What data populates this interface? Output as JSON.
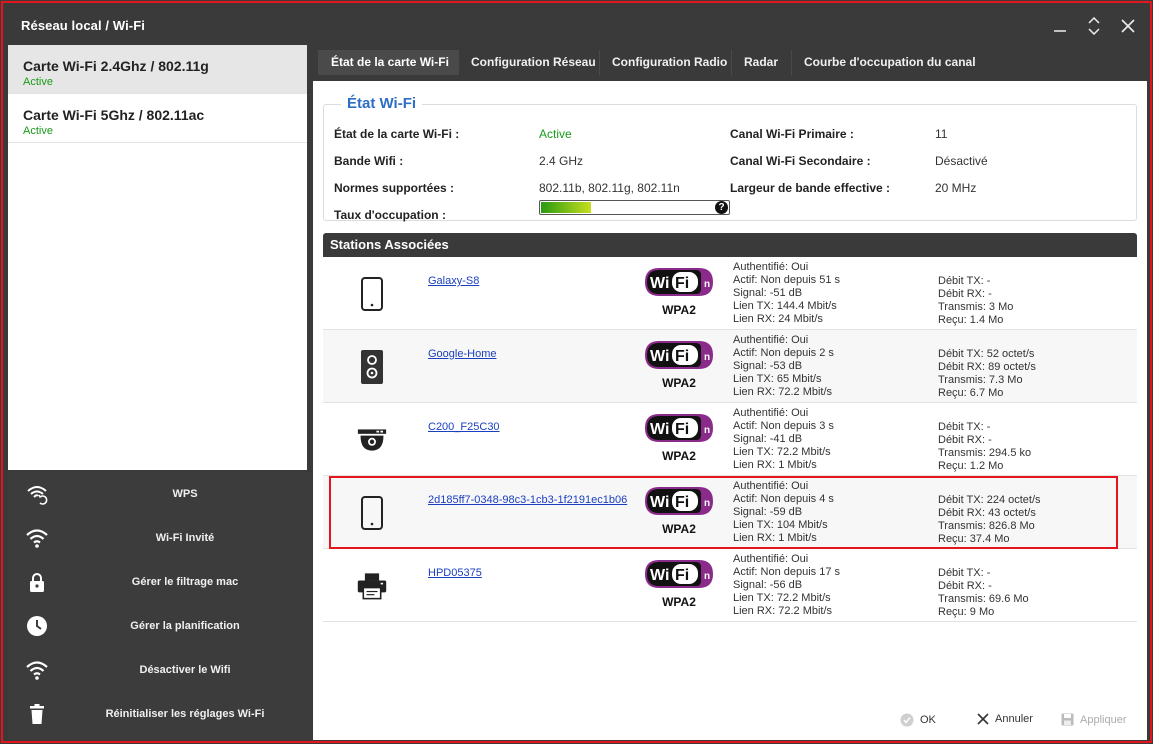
{
  "window": {
    "title": "Réseau local / Wi-Fi"
  },
  "cards": [
    {
      "name": "Carte Wi-Fi 2.4Ghz / 802.11g",
      "state": "Active"
    },
    {
      "name": "Carte Wi-Fi 5Ghz / 802.11ac",
      "state": "Active"
    }
  ],
  "actions": [
    {
      "label": "WPS",
      "icon": "wps-icon"
    },
    {
      "label": "Wi-Fi Invité",
      "icon": "wifi-icon"
    },
    {
      "label": "Gérer le filtrage mac",
      "icon": "lock-icon"
    },
    {
      "label": "Gérer la planification",
      "icon": "clock-icon"
    },
    {
      "label": "Désactiver le Wifi",
      "icon": "wifi-off-icon"
    },
    {
      "label": "Réinitialiser les réglages Wi-Fi",
      "icon": "trash-icon"
    }
  ],
  "tabs": [
    {
      "label": "État de la carte Wi-Fi"
    },
    {
      "label": "Configuration Réseau"
    },
    {
      "label": "Configuration Radio"
    },
    {
      "label": "Radar"
    },
    {
      "label": "Courbe d'occupation du canal"
    }
  ],
  "status": {
    "title": "État Wi-Fi",
    "card_state_label": "État de la carte Wi-Fi :",
    "card_state_value": "Active",
    "band_label": "Bande Wifi :",
    "band_value": "2.4 GHz",
    "norms_label": "Normes supportées :",
    "norms_value": "802.11b, 802.11g, 802.11n",
    "occupancy_label": "Taux d'occupation :",
    "occupancy_fraction": 0.27,
    "occupancy_help": "?",
    "primary_label": "Canal Wi-Fi Primaire :",
    "primary_value": "11",
    "secondary_label": "Canal Wi-Fi Secondaire :",
    "secondary_value": "Désactivé",
    "bandwidth_label": "Largeur de bande effective :",
    "bandwidth_value": "20 MHz"
  },
  "stations_title": "Stations Associées",
  "wifi_logo": {
    "text_wi": "Wi",
    "text_fi": "Fi",
    "text_n": "n"
  },
  "stations": [
    {
      "name": "Galaxy-S8",
      "icon": "phone-icon",
      "security": "WPA2",
      "info": [
        "Authentifié: Oui",
        "Actif: Non depuis 51 s",
        "Signal: -51 dB",
        "Lien TX: 144.4 Mbit/s",
        "Lien RX: 24 Mbit/s"
      ],
      "rates": [
        "Débit TX: -",
        "Débit RX: -",
        "Transmis: 3 Mo",
        "Reçu: 1.4 Mo"
      ]
    },
    {
      "name": "Google-Home",
      "icon": "speaker-icon",
      "security": "WPA2",
      "info": [
        "Authentifié: Oui",
        "Actif: Non depuis 2 s",
        "Signal: -53 dB",
        "Lien TX: 65 Mbit/s",
        "Lien RX: 72.2 Mbit/s"
      ],
      "rates": [
        "Débit TX: 52 octet/s",
        "Débit RX: 89 octet/s",
        "Transmis: 7.3 Mo",
        "Reçu: 6.7 Mo"
      ]
    },
    {
      "name": "C200_F25C30",
      "icon": "camera-icon",
      "security": "WPA2",
      "info": [
        "Authentifié: Oui",
        "Actif: Non depuis 3 s",
        "Signal: -41 dB",
        "Lien TX: 72.2 Mbit/s",
        "Lien RX: 1 Mbit/s"
      ],
      "rates": [
        "Débit TX: -",
        "Débit RX: -",
        "Transmis: 294.5 ko",
        "Reçu: 1.2 Mo"
      ]
    },
    {
      "name": "2d185ff7-0348-98c3-1cb3-1f2191ec1b06",
      "icon": "phone-icon",
      "security": "WPA2",
      "info": [
        "Authentifié: Oui",
        "Actif: Non depuis 4 s",
        "Signal: -59 dB",
        "Lien TX: 104 Mbit/s",
        "Lien RX: 1 Mbit/s"
      ],
      "rates": [
        "Débit TX: 224 octet/s",
        "Débit RX: 43 octet/s",
        "Transmis: 826.8 Mo",
        "Reçu: 37.4 Mo"
      ]
    },
    {
      "name": "HPD05375",
      "icon": "printer-icon",
      "security": "WPA2",
      "info": [
        "Authentifié: Oui",
        "Actif: Non depuis 17 s",
        "Signal: -56 dB",
        "Lien TX: 72.2 Mbit/s",
        "Lien RX: 72.2 Mbit/s"
      ],
      "rates": [
        "Débit TX: -",
        "Débit RX: -",
        "Transmis: 69.6 Mo",
        "Reçu: 9 Mo"
      ]
    }
  ],
  "footer": {
    "ok": "OK",
    "cancel": "Annuler",
    "apply": "Appliquer"
  },
  "colors": {
    "accent": "#2e6ec5",
    "active": "#1a9a1a",
    "highlight": "#e4161d",
    "link": "#1a3fbf"
  }
}
